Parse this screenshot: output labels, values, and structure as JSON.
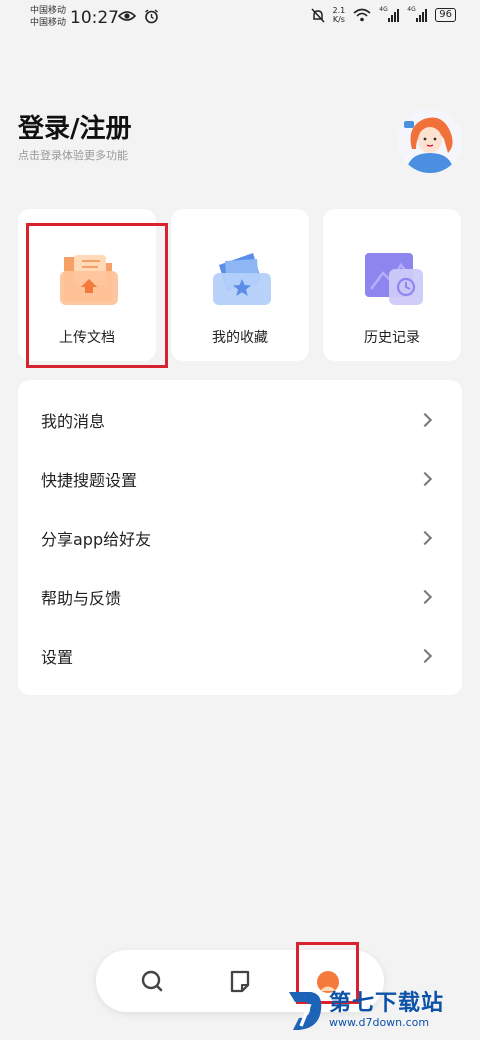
{
  "status_bar": {
    "carrier_1": "中国移动",
    "carrier_2": "中国移动",
    "time": "10:27",
    "net_speed_value": "2.1",
    "net_speed_unit": "K/s",
    "signal_tag_1": "4G",
    "signal_tag_2": "4G",
    "battery": "96"
  },
  "header": {
    "title": "登录/注册",
    "subtitle": "点击登录体验更多功能"
  },
  "quick_cards": [
    {
      "label": "上传文档",
      "icon": "upload-folder-icon"
    },
    {
      "label": "我的收藏",
      "icon": "favorites-folder-icon"
    },
    {
      "label": "历史记录",
      "icon": "history-clock-icon"
    }
  ],
  "menu": [
    {
      "label": "我的消息"
    },
    {
      "label": "快捷搜题设置"
    },
    {
      "label": "分享app给好友"
    },
    {
      "label": "帮助与反馈"
    },
    {
      "label": "设置"
    }
  ],
  "bottom_nav": [
    {
      "icon": "search-icon"
    },
    {
      "icon": "notes-icon"
    },
    {
      "icon": "profile-icon"
    }
  ],
  "watermark": {
    "text": "第七下载站",
    "url": "www.d7down.com"
  },
  "colors": {
    "accent_orange": "#f47a3c",
    "highlight_red": "#d8232f",
    "watermark_blue": "#0c52a8"
  }
}
